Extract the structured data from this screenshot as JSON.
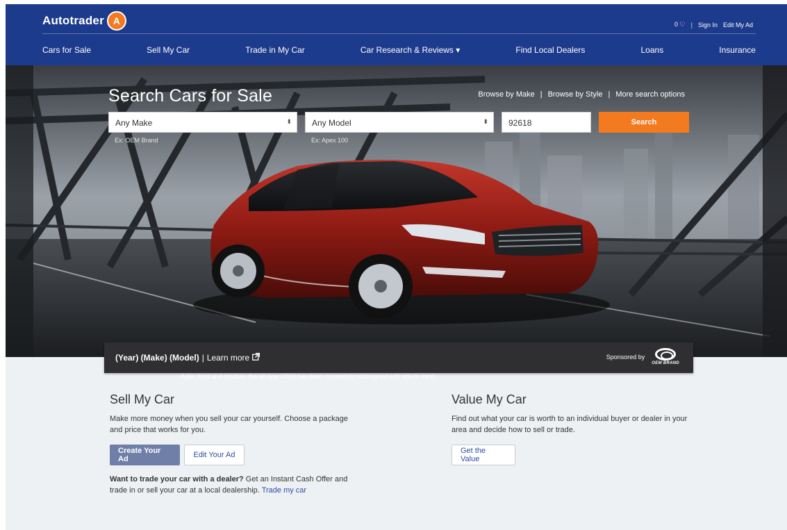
{
  "header": {
    "logo_text": "Autotrader",
    "logo_mark": "A",
    "saved_count": "0",
    "heart_icon": "heart-outline-icon",
    "sign_in": "Sign In",
    "edit_my_ad": "Edit My Ad",
    "separator": "|"
  },
  "nav": {
    "items": [
      "Cars for Sale",
      "Sell My Car",
      "Trade in My Car",
      "Car Research & Reviews",
      "Find Local Dealers",
      "Loans",
      "Insurance"
    ],
    "dropdown_caret": "▾"
  },
  "hero": {
    "title": "Search Cars for Sale",
    "browse_by_make": "Browse by Make",
    "browse_by_style": "Browse by Style",
    "more_options": "More search options",
    "separator": "|",
    "make_value": "Any Make",
    "model_value": "Any Model",
    "zip_value": "92618",
    "search_label": "Search",
    "make_hint": "Ex: OEM Brand",
    "model_hint": "Ex: Apex 100",
    "select_arrow": "⬍"
  },
  "sponsor": {
    "vehicle": "(Year) (Make) (Model)",
    "separator": "|",
    "learn_more": "Learn more",
    "external_icon": "external-link-icon",
    "sponsored_by": "Sponsored by",
    "brand": "OEM BRAND",
    "tagline": "Agile, bold and intuitive, the all-new XC60 has been completely redesigned with you in mind."
  },
  "sell": {
    "title": "Sell My Car",
    "body": "Make more money when you sell your car yourself. Choose a package and price that works for you.",
    "create_ad": "Create Your Ad",
    "edit_ad": "Edit Your Ad",
    "trade_bold": "Want to trade your car with a dealer?",
    "trade_text": " Get an Instant Cash Offer and trade in or sell your car at a local dealership. ",
    "trade_link": "Trade my car"
  },
  "value": {
    "title": "Value My Car",
    "body": "Find out what your car is worth to an individual buyer or dealer in your area and decide how to sell or trade.",
    "get_value": "Get the Value"
  },
  "colors": {
    "header_bg": "#1d3b8c",
    "accent_orange": "#f47a20",
    "link_blue": "#2c4c9f",
    "car_red": "#8e1b14"
  }
}
